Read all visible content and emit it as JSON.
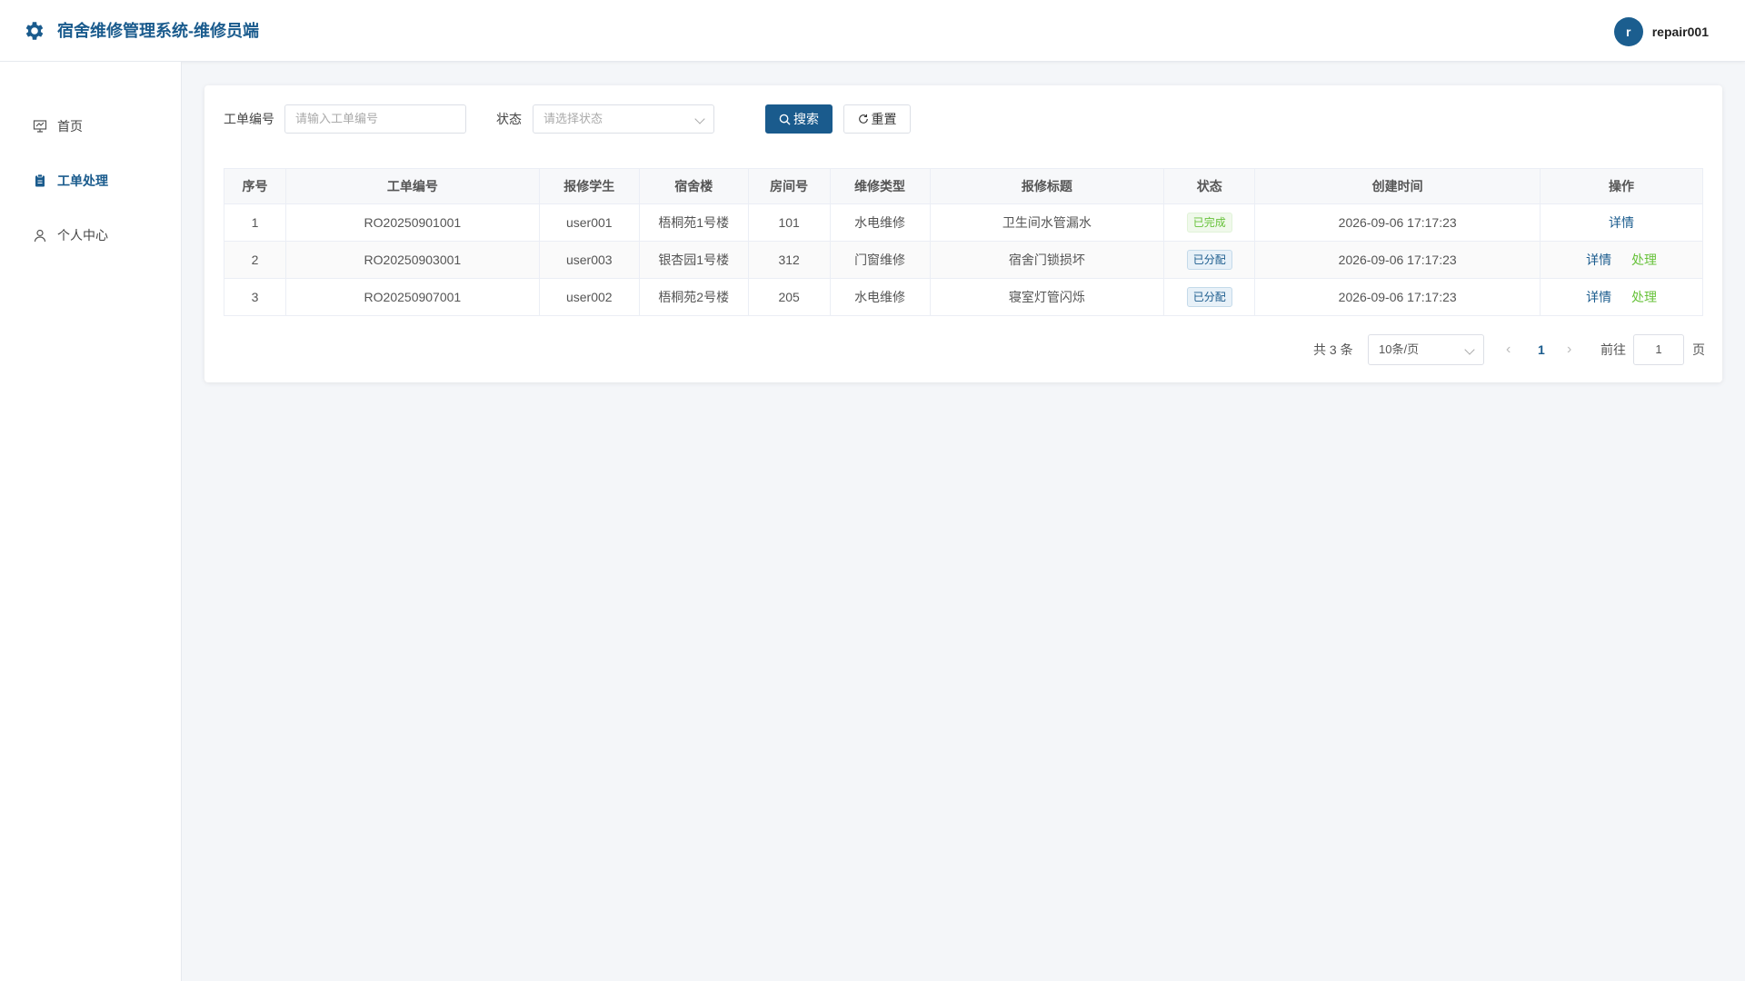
{
  "header": {
    "title": "宿舍维修管理系统-维修员端",
    "avatar_letter": "r",
    "username": "repair001"
  },
  "sidebar": {
    "items": [
      {
        "label": "首页",
        "icon": "presentation-icon",
        "active": false
      },
      {
        "label": "工单处理",
        "icon": "clipboard-icon",
        "active": true
      },
      {
        "label": "个人中心",
        "icon": "user-icon",
        "active": false
      }
    ]
  },
  "search": {
    "order_no_label": "工单编号",
    "order_no_placeholder": "请输入工单编号",
    "status_label": "状态",
    "status_placeholder": "请选择状态",
    "search_button": "搜索",
    "reset_button": "重置"
  },
  "table": {
    "columns": [
      "序号",
      "工单编号",
      "报修学生",
      "宿舍楼",
      "房间号",
      "维修类型",
      "报修标题",
      "状态",
      "创建时间",
      "操作"
    ],
    "rows": [
      {
        "index": "1",
        "order_no": "RO20250901001",
        "student": "user001",
        "building": "梧桐苑1号楼",
        "room": "101",
        "type": "水电维修",
        "title": "卫生间水管漏水",
        "status": "已完成",
        "created": "2026-09-06 17:17:23",
        "actions": [
          "详情"
        ]
      },
      {
        "index": "2",
        "order_no": "RO20250903001",
        "student": "user003",
        "building": "银杏园1号楼",
        "room": "312",
        "type": "门窗维修",
        "title": "宿舍门锁损坏",
        "status": "已分配",
        "created": "2026-09-06 17:17:23",
        "actions": [
          "详情",
          "处理"
        ]
      },
      {
        "index": "3",
        "order_no": "RO20250907001",
        "student": "user002",
        "building": "梧桐苑2号楼",
        "room": "205",
        "type": "水电维修",
        "title": "寝室灯管闪烁",
        "status": "已分配",
        "created": "2026-09-06 17:17:23",
        "actions": [
          "详情",
          "处理"
        ]
      }
    ]
  },
  "pagination": {
    "total_text": "共 3 条",
    "page_size": "10条/页",
    "current_page": "1",
    "goto_label": "前往",
    "goto_value": "1",
    "page_suffix": "页"
  },
  "colors": {
    "primary": "#1a5b8d",
    "success": "#67c23a"
  }
}
